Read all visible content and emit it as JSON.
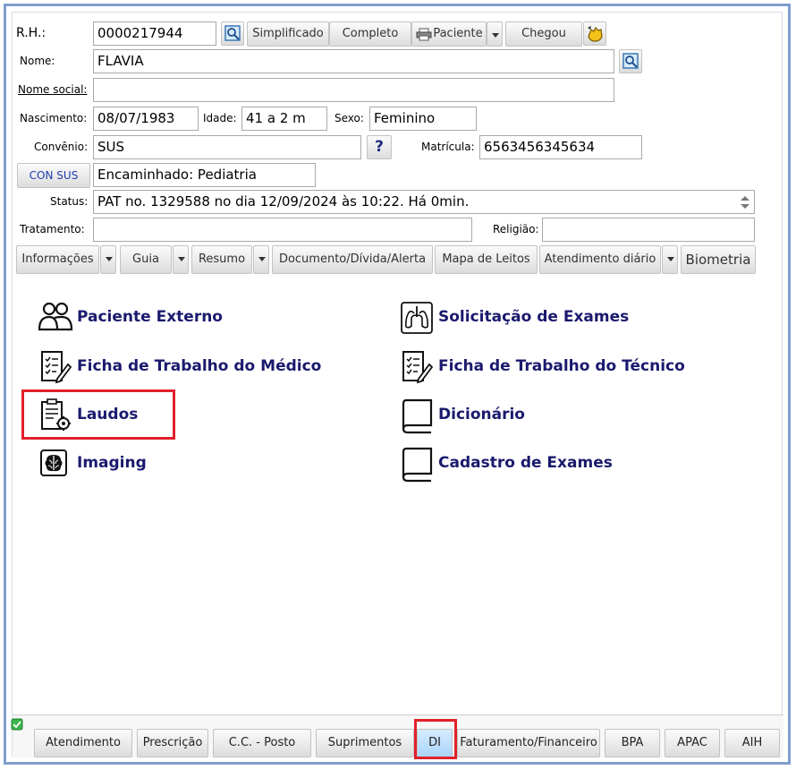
{
  "patient": {
    "rh_label": "R.H.:",
    "rh_value": "0000217944",
    "nome_label": "Nome:",
    "nome_value": "FLAVIA",
    "nome_social_label": "Nome social:",
    "nome_social_value": "",
    "nascimento_label": "Nascimento:",
    "nascimento_value": "08/07/1983",
    "idade_label": "Idade:",
    "idade_value": "41 a 2 m",
    "sexo_label": "Sexo:",
    "sexo_value": "Feminino",
    "convenio_label": "Convênio:",
    "convenio_value": "SUS",
    "matricula_label": "Matrícula:",
    "matricula_value": "6563456345634",
    "con_sus_label": "CON SUS",
    "encaminhado_value": "Encaminhado: Pediatria",
    "status_label": "Status:",
    "status_value": "PAT no. 1329588 no dia 12/09/2024  às  10:22. Há 0min.",
    "tratamento_label": "Tratamento:",
    "tratamento_value": "",
    "religiao_label": "Religião:",
    "religiao_value": "",
    "help_glyph": "?"
  },
  "top_buttons": {
    "simplificado": "Simplificado",
    "completo": "Completo",
    "paciente": "Paciente",
    "chegou": "Chegou"
  },
  "action_buttons": {
    "informacoes": "Informações",
    "guia": "Guia",
    "resumo": "Resumo",
    "documento": "Documento/Dívida/Alerta",
    "mapa": "Mapa de Leitos",
    "atendimento_diario": "Atendimento diário",
    "biometria": "Biometria"
  },
  "menu": {
    "left": [
      {
        "label": "Paciente Externo",
        "icon": "people-icon"
      },
      {
        "label": "Ficha de Trabalho do Médico",
        "icon": "checklist-pencil-icon"
      },
      {
        "label": "Laudos",
        "icon": "clipboard-gear-icon"
      },
      {
        "label": "Imaging",
        "icon": "brain-icon"
      }
    ],
    "right": [
      {
        "label": "Solicitação de Exames",
        "icon": "lungs-icon"
      },
      {
        "label": "Ficha de Trabalho do Técnico",
        "icon": "checklist-pencil-icon"
      },
      {
        "label": "Dicionário",
        "icon": "book-icon"
      },
      {
        "label": "Cadastro de Exames",
        "icon": "book-icon"
      }
    ]
  },
  "bottom_tabs": [
    "Atendimento",
    "Prescrição",
    "C.C. - Posto",
    "Suprimentos",
    "DI",
    "Faturamento/Financeiro",
    "BPA",
    "APAC",
    "AIH"
  ],
  "colors": {
    "highlight": "#e0212b",
    "menu_text": "#1a1a6e",
    "frame": "#7f9dcd",
    "active_tab": "#a9d4fa"
  }
}
